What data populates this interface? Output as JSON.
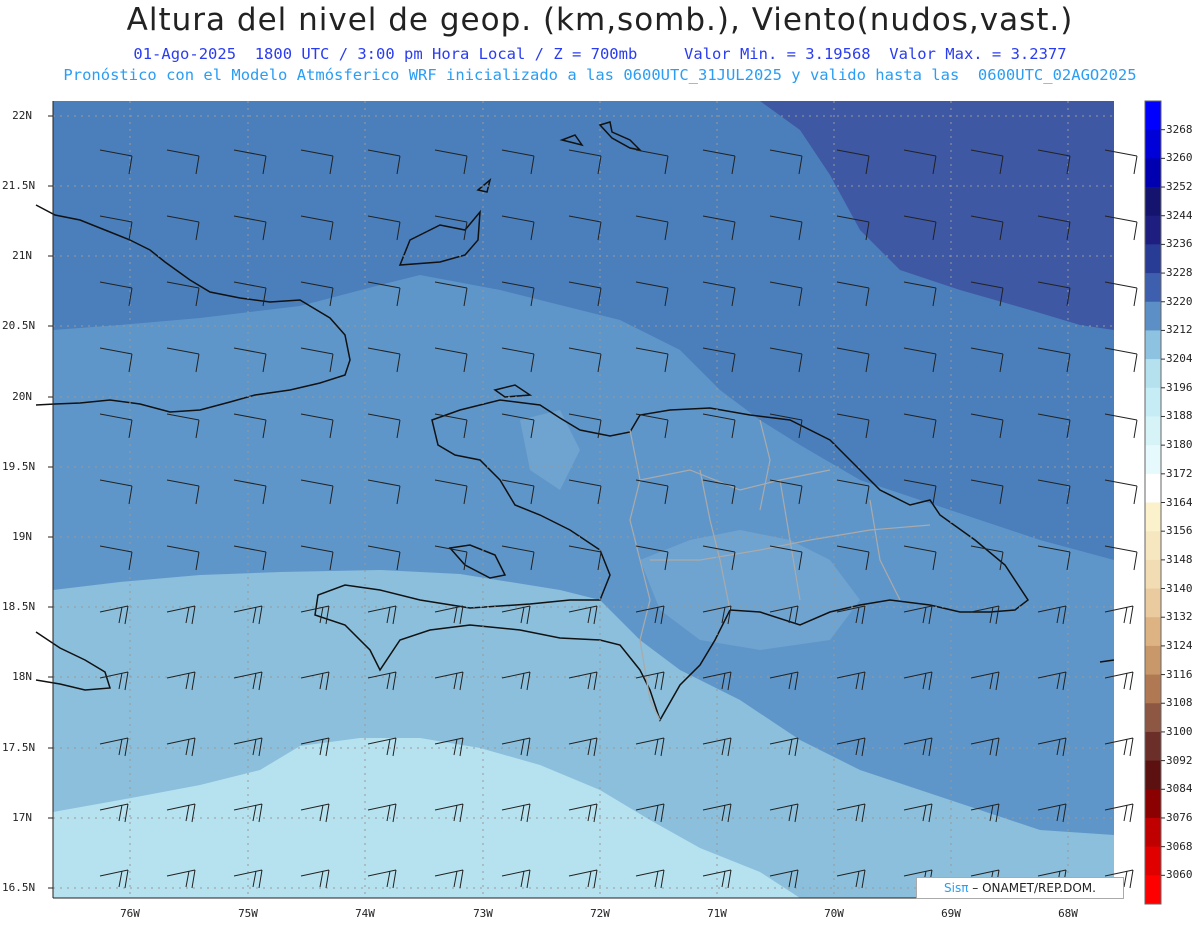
{
  "header": {
    "title": "Altura del nivel de geop. (km,somb.), Viento(nudos,vast.)",
    "subtitle_left": "01-Ago-2025  1800 UTC / 3:00 pm Hora Local / Z = 700mb",
    "subtitle_right": "Valor Min. = 3.19568  Valor Max. = 3.2377",
    "model_line": "Pronóstico con el Modelo Atmósferico WRF inicializado a las 0600UTC_31JUL2025 y valido hasta las  0600UTC_02AGO2025"
  },
  "axes": {
    "lat_labels": [
      "22N",
      "21.5N",
      "21N",
      "20.5N",
      "20N",
      "19.5N",
      "19N",
      "18.5N",
      "18N",
      "17.5N",
      "17N",
      "16.5N"
    ],
    "lon_labels": [
      "76W",
      "75W",
      "74W",
      "73W",
      "72W",
      "71W",
      "70W",
      "69W",
      "68W"
    ]
  },
  "colorbar": {
    "labels": [
      "3268",
      "3260",
      "3252",
      "3244",
      "3236",
      "3228",
      "3220",
      "3212",
      "3204",
      "3196",
      "3188",
      "3180",
      "3172",
      "3164",
      "3156",
      "3148",
      "3140",
      "3132",
      "3124",
      "3116",
      "3108",
      "3100",
      "3092",
      "3084",
      "3076",
      "3068",
      "3060"
    ],
    "colors": [
      "#0000ff",
      "#0000d8",
      "#0000b0",
      "#14146e",
      "#1e1e80",
      "#283c96",
      "#3d5fad",
      "#5c8fc6",
      "#8dc2e0",
      "#b5e1ef",
      "#c6ecf5",
      "#d6f3f8",
      "#e6f9fc",
      "#ffffff",
      "#fbf2cc",
      "#f6e7c0",
      "#f1dcb4",
      "#eacba0",
      "#ddb384",
      "#c9986a",
      "#b07853",
      "#8e5743",
      "#6b2e28",
      "#5c1010",
      "#8b0000",
      "#c00000",
      "#e00000",
      "#ff0000"
    ]
  },
  "fill_colors": {
    "band_3228": "#3f58a3",
    "band_3220": "#4a7fbb",
    "band_3212": "#5f96c9",
    "band_3204": "#8bbfdc",
    "band_3196": "#b6e2ef"
  },
  "credit": {
    "sis": "Sis",
    "pi": "π",
    "org": " – ONAMET/REP.DOM."
  }
}
